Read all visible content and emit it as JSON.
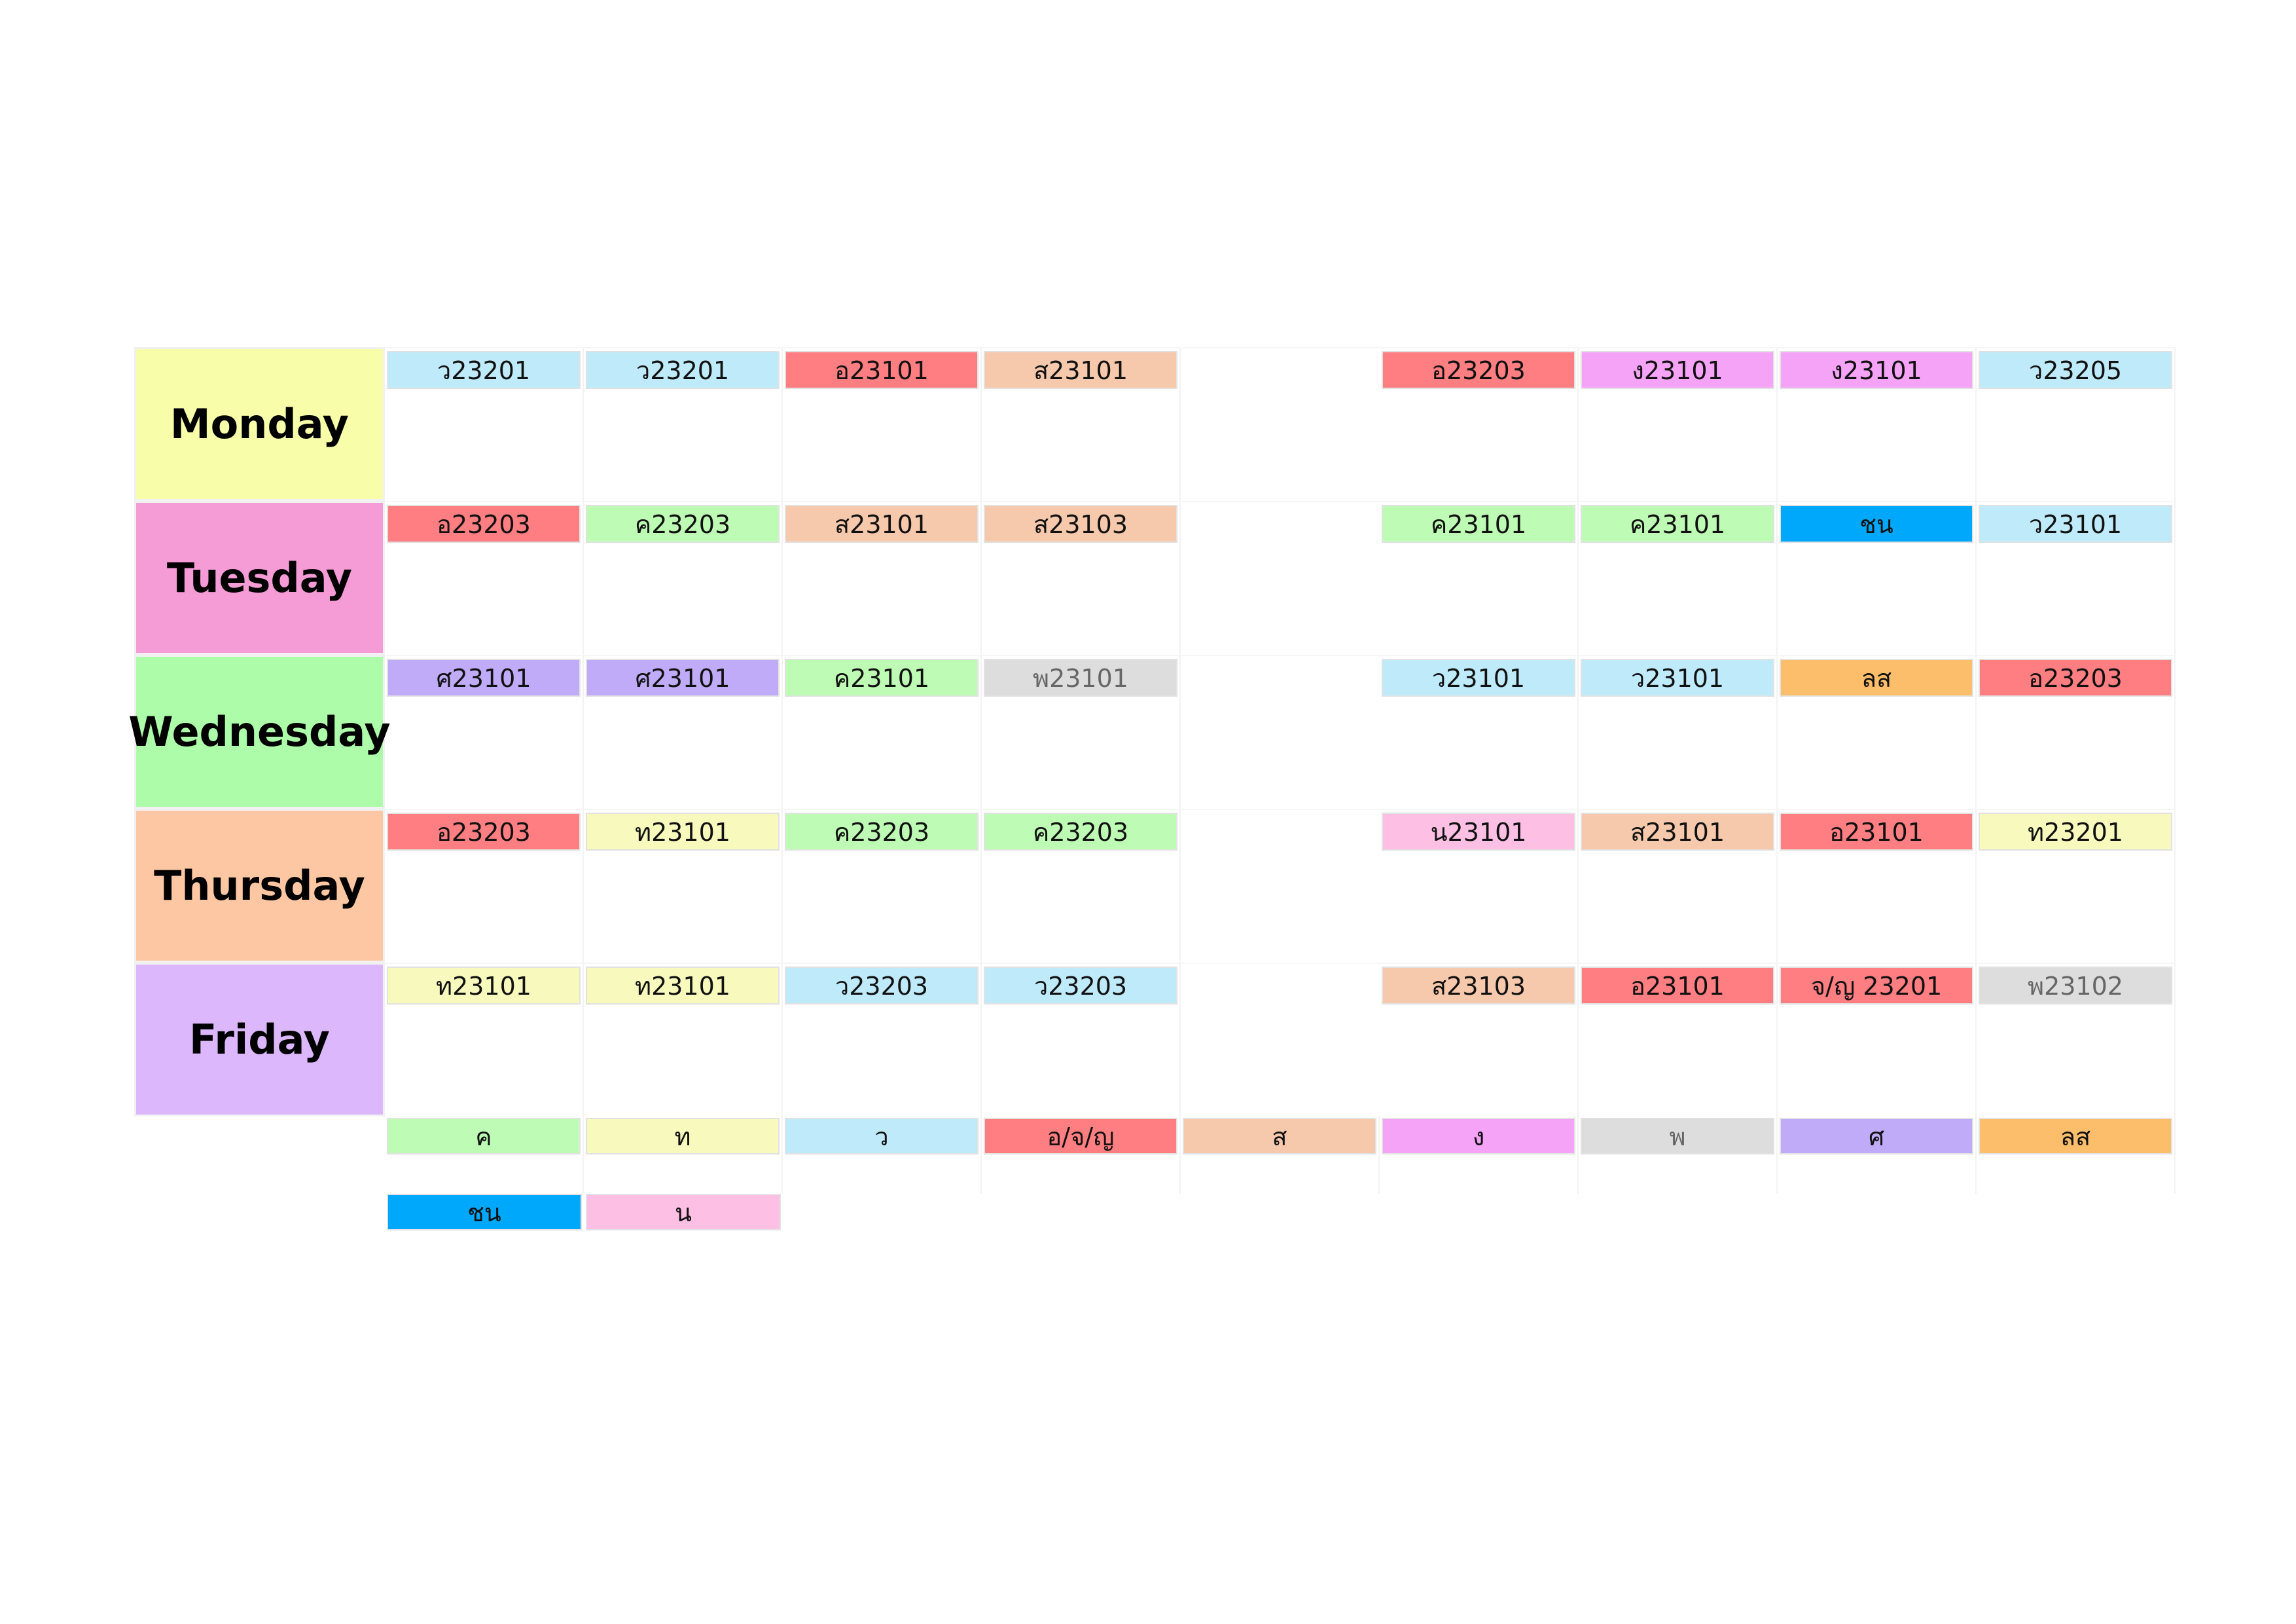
{
  "days": [
    {
      "name": "Monday",
      "color": "#f7fda8"
    },
    {
      "name": "Tuesday",
      "color": "#f59bd6"
    },
    {
      "name": "Wednesday",
      "color": "#adfca9"
    },
    {
      "name": "Thursday",
      "color": "#fdc7a4"
    },
    {
      "name": "Friday",
      "color": "#dcb7fb"
    }
  ],
  "schedule": [
    [
      "ว23201",
      "ว23201",
      "อ23101",
      "ส23101",
      "",
      "อ23203",
      "ง23101",
      "ง23101",
      "ว23205"
    ],
    [
      "อ23203",
      "ค23203",
      "ส23101",
      "ส23103",
      "",
      "ค23101",
      "ค23101",
      "ชน",
      "ว23101"
    ],
    [
      "ศ23101",
      "ศ23101",
      "ค23101",
      "พ23101",
      "",
      "ว23101",
      "ว23101",
      "ลส",
      "อ23203"
    ],
    [
      "อ23203",
      "ท23101",
      "ค23203",
      "ค23203",
      "",
      "น23101",
      "ส23101",
      "อ23101",
      "ท23201"
    ],
    [
      "ท23101",
      "ท23101",
      "ว23203",
      "ว23203",
      "",
      "ส23103",
      "อ23101",
      "จ/ญ 23201",
      "พ23102"
    ]
  ],
  "legend_row1": [
    "ค",
    "ท",
    "ว",
    "อ/จ/ญ",
    "ส",
    "ง",
    "พ",
    "ศ",
    "ลส"
  ],
  "legend_row2": [
    "ชน",
    "น"
  ],
  "subject_colors": {
    "ค": "#befcb5",
    "ท": "#f8f9bd",
    "ว": "#bfeaf9",
    "อ": "#fe7e81",
    "อ/จ/ญ": "#fe7e81",
    "จ/ญ": "#fe7e81",
    "ส": "#f6c9ac",
    "ง": "#f5a3f6",
    "พ": "#dddddd",
    "ศ": "#bfabf8",
    "ลส": "#fcbe6b",
    "ชน": "#00a8fb",
    "น": "#fdc0e4"
  }
}
